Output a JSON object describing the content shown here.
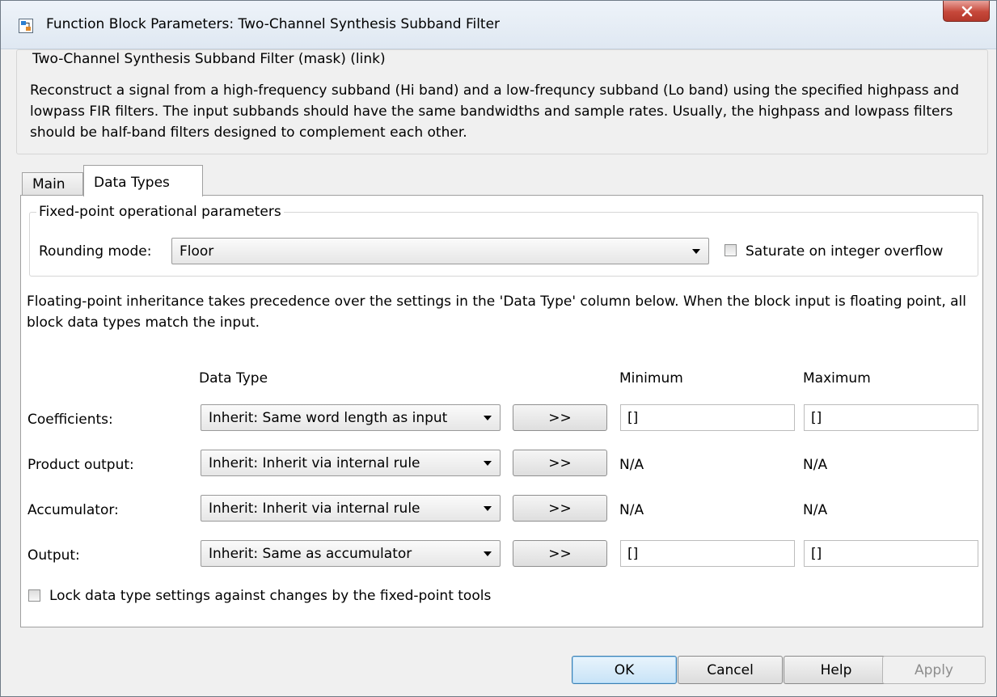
{
  "window": {
    "title": "Function Block Parameters: Two-Channel Synthesis Subband Filter"
  },
  "description": {
    "legend": "Two-Channel Synthesis Subband Filter (mask) (link)",
    "text": "Reconstruct a signal from a high-frequency subband (Hi band) and a low-frequncy subband (Lo band) using the specified highpass and lowpass FIR filters.  The input subbands should have the same bandwidths and sample rates. Usually, the highpass and lowpass filters should be half-band filters designed to complement each other."
  },
  "tabs": [
    {
      "label": "Main",
      "active": false
    },
    {
      "label": "Data Types",
      "active": true
    }
  ],
  "fixed_point": {
    "legend": "Fixed-point operational parameters",
    "rounding_label": "Rounding mode:",
    "rounding_value": "Floor",
    "saturate_label": "Saturate on integer overflow",
    "saturate_checked": false
  },
  "info_text": "Floating-point inheritance takes precedence over the settings in the 'Data Type' column below. When the block input is floating point, all block data types match the input.",
  "table": {
    "headers": {
      "data_type": "Data Type",
      "minimum": "Minimum",
      "maximum": "Maximum"
    },
    "assistant_label": ">>",
    "rows": [
      {
        "label": "Coefficients:",
        "data_type": "Inherit: Same word length as input",
        "minimum": "[]",
        "maximum": "[]"
      },
      {
        "label": "Product output:",
        "data_type": "Inherit: Inherit via internal rule",
        "minimum": "N/A",
        "maximum": "N/A"
      },
      {
        "label": "Accumulator:",
        "data_type": "Inherit: Inherit via internal rule",
        "minimum": "N/A",
        "maximum": "N/A"
      },
      {
        "label": "Output:",
        "data_type": "Inherit: Same as accumulator",
        "minimum": "[]",
        "maximum": "[]"
      }
    ]
  },
  "lock": {
    "label": "Lock data type settings against changes by the fixed-point tools",
    "checked": false
  },
  "footer": {
    "ok": "OK",
    "cancel": "Cancel",
    "help": "Help",
    "apply": "Apply"
  }
}
